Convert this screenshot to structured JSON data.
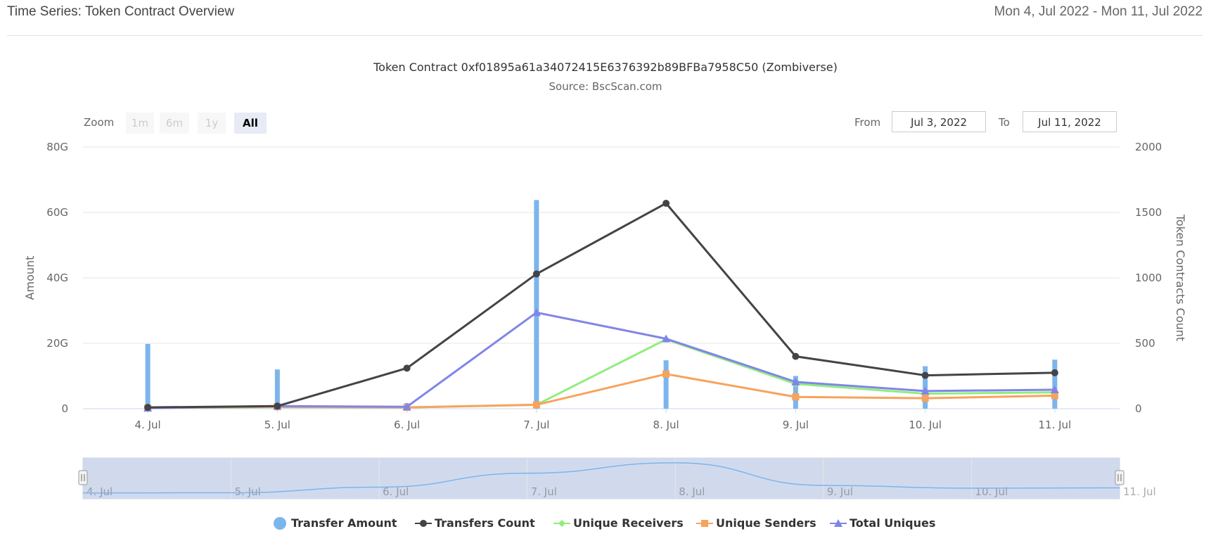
{
  "header": {
    "title": "Time Series: Token Contract Overview",
    "date_range": "Mon 4, Jul 2022 - Mon 11, Jul 2022"
  },
  "zoom": {
    "label": "Zoom",
    "buttons": [
      "1m",
      "6m",
      "1y",
      "All"
    ],
    "active": "All"
  },
  "range_selector": {
    "from_label": "From",
    "from_value": "Jul 3, 2022",
    "to_label": "To",
    "to_value": "Jul 11, 2022"
  },
  "colors": {
    "transfer_amount": "#7cb5ec",
    "transfers_count": "#434348",
    "unique_receivers": "#90ed7d",
    "unique_senders": "#f7a35c",
    "total_uniques": "#8085e9",
    "grid": "#e6e6e6",
    "navigator_fill": "#ccd6eb"
  },
  "chart_data": {
    "type": "line",
    "title": "Token Contract 0xf01895a61a34072415E6376392b89BFBa7958C50 (Zombiverse)",
    "subtitle": "Source: BscScan.com",
    "categories": [
      "4. Jul",
      "5. Jul",
      "6. Jul",
      "7. Jul",
      "8. Jul",
      "9. Jul",
      "10. Jul",
      "11. Jul"
    ],
    "y_left": {
      "label": "Amount",
      "ticks": [
        "0",
        "20G",
        "40G",
        "60G",
        "80G"
      ],
      "range": [
        0,
        80000000000
      ]
    },
    "y_right": {
      "label": "Token Contracts Count",
      "ticks": [
        "0",
        "500",
        "1000",
        "1500",
        "2000"
      ],
      "range": [
        0,
        2000
      ]
    },
    "series": [
      {
        "name": "Transfer Amount",
        "type": "column",
        "axis": "left",
        "values": [
          19800000000,
          12000000000,
          1700000000,
          63800000000,
          14800000000,
          10000000000,
          13000000000,
          15000000000
        ]
      },
      {
        "name": "Transfers Count",
        "type": "line",
        "axis": "right",
        "marker": "circle",
        "values": [
          10,
          20,
          310,
          1030,
          1570,
          400,
          255,
          275
        ]
      },
      {
        "name": "Unique Receivers",
        "type": "line",
        "axis": "right",
        "marker": "diamond",
        "values": [
          5,
          12,
          10,
          30,
          530,
          190,
          115,
          125
        ]
      },
      {
        "name": "Unique Senders",
        "type": "line",
        "axis": "right",
        "marker": "square",
        "values": [
          5,
          15,
          10,
          30,
          265,
          90,
          80,
          100
        ]
      },
      {
        "name": "Total Uniques",
        "type": "line",
        "axis": "right",
        "marker": "triangle",
        "values": [
          5,
          20,
          15,
          735,
          535,
          205,
          135,
          145
        ]
      }
    ],
    "navigator": {
      "labels": [
        "4. Jul",
        "5. Jul",
        "6. Jul",
        "7. Jul",
        "8. Jul",
        "9. Jul",
        "10. Jul",
        "11. Jul"
      ],
      "values": [
        10,
        20,
        310,
        1030,
        1570,
        400,
        255,
        275
      ]
    },
    "grid": true,
    "legend": "bottom-center"
  }
}
